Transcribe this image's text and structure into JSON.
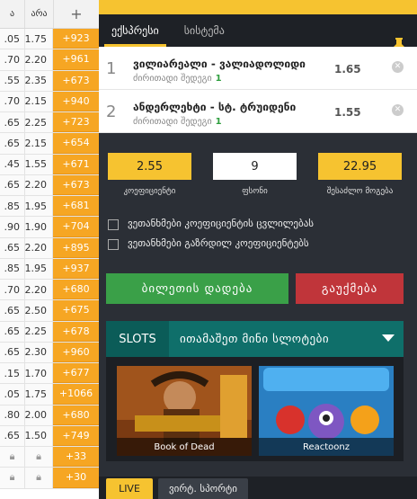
{
  "odds_table": {
    "header": {
      "col1": "ა",
      "col2": "არა",
      "add_icon": "plus-icon"
    },
    "rows": [
      {
        "c1": ".05",
        "c2": "1.75",
        "c3": "+923"
      },
      {
        "c1": ".70",
        "c2": "2.20",
        "c3": "+961"
      },
      {
        "c1": ".55",
        "c2": "2.35",
        "c3": "+673"
      },
      {
        "c1": ".70",
        "c2": "2.15",
        "c3": "+940"
      },
      {
        "c1": ".65",
        "c2": "2.25",
        "c3": "+723"
      },
      {
        "c1": ".65",
        "c2": "2.15",
        "c3": "+654"
      },
      {
        "c1": ".45",
        "c2": "1.55",
        "c3": "+671"
      },
      {
        "c1": ".65",
        "c2": "2.20",
        "c3": "+673"
      },
      {
        "c1": ".85",
        "c2": "1.95",
        "c3": "+681"
      },
      {
        "c1": ".90",
        "c2": "1.90",
        "c3": "+704"
      },
      {
        "c1": ".65",
        "c2": "2.20",
        "c3": "+895"
      },
      {
        "c1": ".85",
        "c2": "1.95",
        "c3": "+937"
      },
      {
        "c1": ".70",
        "c2": "2.20",
        "c3": "+680"
      },
      {
        "c1": ".65",
        "c2": "2.50",
        "c3": "+675"
      },
      {
        "c1": ".65",
        "c2": "2.25",
        "c3": "+678"
      },
      {
        "c1": ".65",
        "c2": "2.30",
        "c3": "+960"
      },
      {
        "c1": ".15",
        "c2": "1.70",
        "c3": "+677"
      },
      {
        "c1": ".05",
        "c2": "1.75",
        "c3": "+1066"
      },
      {
        "c1": ".80",
        "c2": "2.00",
        "c3": "+680"
      },
      {
        "c1": ".65",
        "c2": "1.50",
        "c3": "+749"
      },
      {
        "c1": "",
        "c2": "",
        "c3": "+33",
        "locked": true
      },
      {
        "c1": "",
        "c2": "",
        "c3": "+30",
        "locked": true
      }
    ]
  },
  "betslip": {
    "tabs": [
      {
        "label": "ექსპრესი",
        "active": true
      },
      {
        "label": "სისტემა",
        "active": false
      }
    ],
    "pin_icon": "pin-icon",
    "bets": [
      {
        "num": "1",
        "title": "ვილიარეალი - ვალიადოლიდი",
        "market": "ძირითადი შედეგი",
        "pick": "1",
        "odd": "1.65"
      },
      {
        "num": "2",
        "title": "ანდერლეხტი - სტ. ტრუიდენი",
        "market": "ძირითადი შედეგი",
        "pick": "1",
        "odd": "1.55"
      }
    ],
    "summary": {
      "coef_value": "2.55",
      "coef_label": "კოეფიციენტი",
      "stake_value": "9",
      "stake_label": "ფსონი",
      "win_value": "22.95",
      "win_label": "შესაძლო მოგება",
      "check1": "ვეთანხმები კოეფიციენტის ცვლილებას",
      "check2": "ვეთანხმები გაზრდილ კოეფიციენტებს"
    },
    "place_button": "ბილეთის დადება",
    "cancel_button": "გაუქმება",
    "slots": {
      "tag": "SLOTS",
      "title": "ითამაშეთ მინი სლოტები",
      "games": [
        {
          "name": "Book of Dead"
        },
        {
          "name": "Reactoonz"
        }
      ]
    },
    "bottom_tabs": {
      "live": "LIVE",
      "second": "ვირტ. სპორტი"
    }
  }
}
